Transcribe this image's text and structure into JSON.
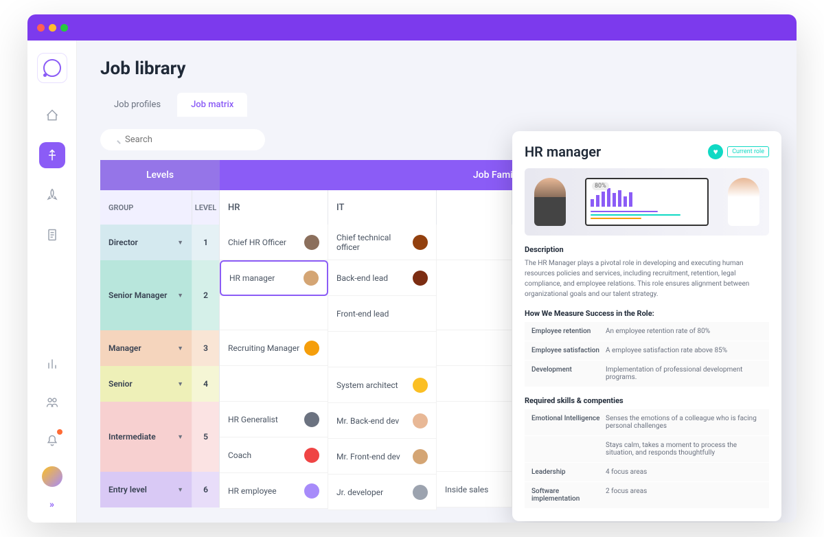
{
  "page": {
    "title": "Job library"
  },
  "tabs": [
    {
      "label": "Job profiles"
    },
    {
      "label": "Job matrix"
    }
  ],
  "search": {
    "placeholder": "Search"
  },
  "matrix": {
    "levels_header": "Levels",
    "family_header": "Job Family",
    "group_header": "GROUP",
    "level_header": "LEVEL",
    "families": [
      "HR",
      "IT"
    ],
    "groups": [
      {
        "name": "Director",
        "level": "1",
        "bg": "#d4e9ef"
      },
      {
        "name": "Senior Manager",
        "level": "2",
        "bg": "#b8e6dc"
      },
      {
        "name": "Manager",
        "level": "3",
        "bg": "#f5d5bd"
      },
      {
        "name": "Senior",
        "level": "4",
        "bg": "#eef0b8"
      },
      {
        "name": "Intermediate",
        "level": "5",
        "bg": "#f7d0d0"
      },
      {
        "name": "Entry level",
        "level": "6",
        "bg": "#d9c9f5"
      }
    ],
    "roles": {
      "director_hr": "Chief HR Officer",
      "director_it": "Chief technical officer",
      "smgr_hr": "HR manager",
      "smgr_it1": "Back-end lead",
      "smgr_it2": "Front-end lead",
      "mgr_hr": "Recruiting Manager",
      "sr_it": "System architect",
      "int_hr1": "HR Generalist",
      "int_hr2": "Coach",
      "int_it1": "Mr. Back-end dev",
      "int_it2": "Mr. Front-end dev",
      "ent_hr": "HR employee",
      "ent_it": "Jr. developer",
      "ent_extra": "Inside sales"
    }
  },
  "detail": {
    "title": "HR manager",
    "badge": "Current role",
    "chart_pct": "80%",
    "desc_title": "Description",
    "desc_text": "The HR Manager plays a pivotal role in developing and executing human resources policies and services, including recruitment, retention, legal compliance, and employee relations. This role ensures alignment between organizational goals and our talent strategy.",
    "success_title": "How We Measure Success in the Role:",
    "success": [
      {
        "label": "Employee retention",
        "value": "An employee retention rate of 80%"
      },
      {
        "label": "Employee satisfaction",
        "value": "A employee satisfaction rate above 85%"
      },
      {
        "label": "Development",
        "value": "Implementation of professional development programs."
      }
    ],
    "skills_title": "Required skills & compenties",
    "skills": [
      {
        "label": "Emotional Intelligence",
        "value": "Senses the emotions of a colleague who is facing personal challenges"
      },
      {
        "label": "",
        "value": "Stays calm, takes a moment to process the situation, and responds thoughtfully"
      },
      {
        "label": "Leadership",
        "value": "4 focus areas"
      },
      {
        "label": "Software implementation",
        "value": "2 focus areas"
      }
    ]
  }
}
